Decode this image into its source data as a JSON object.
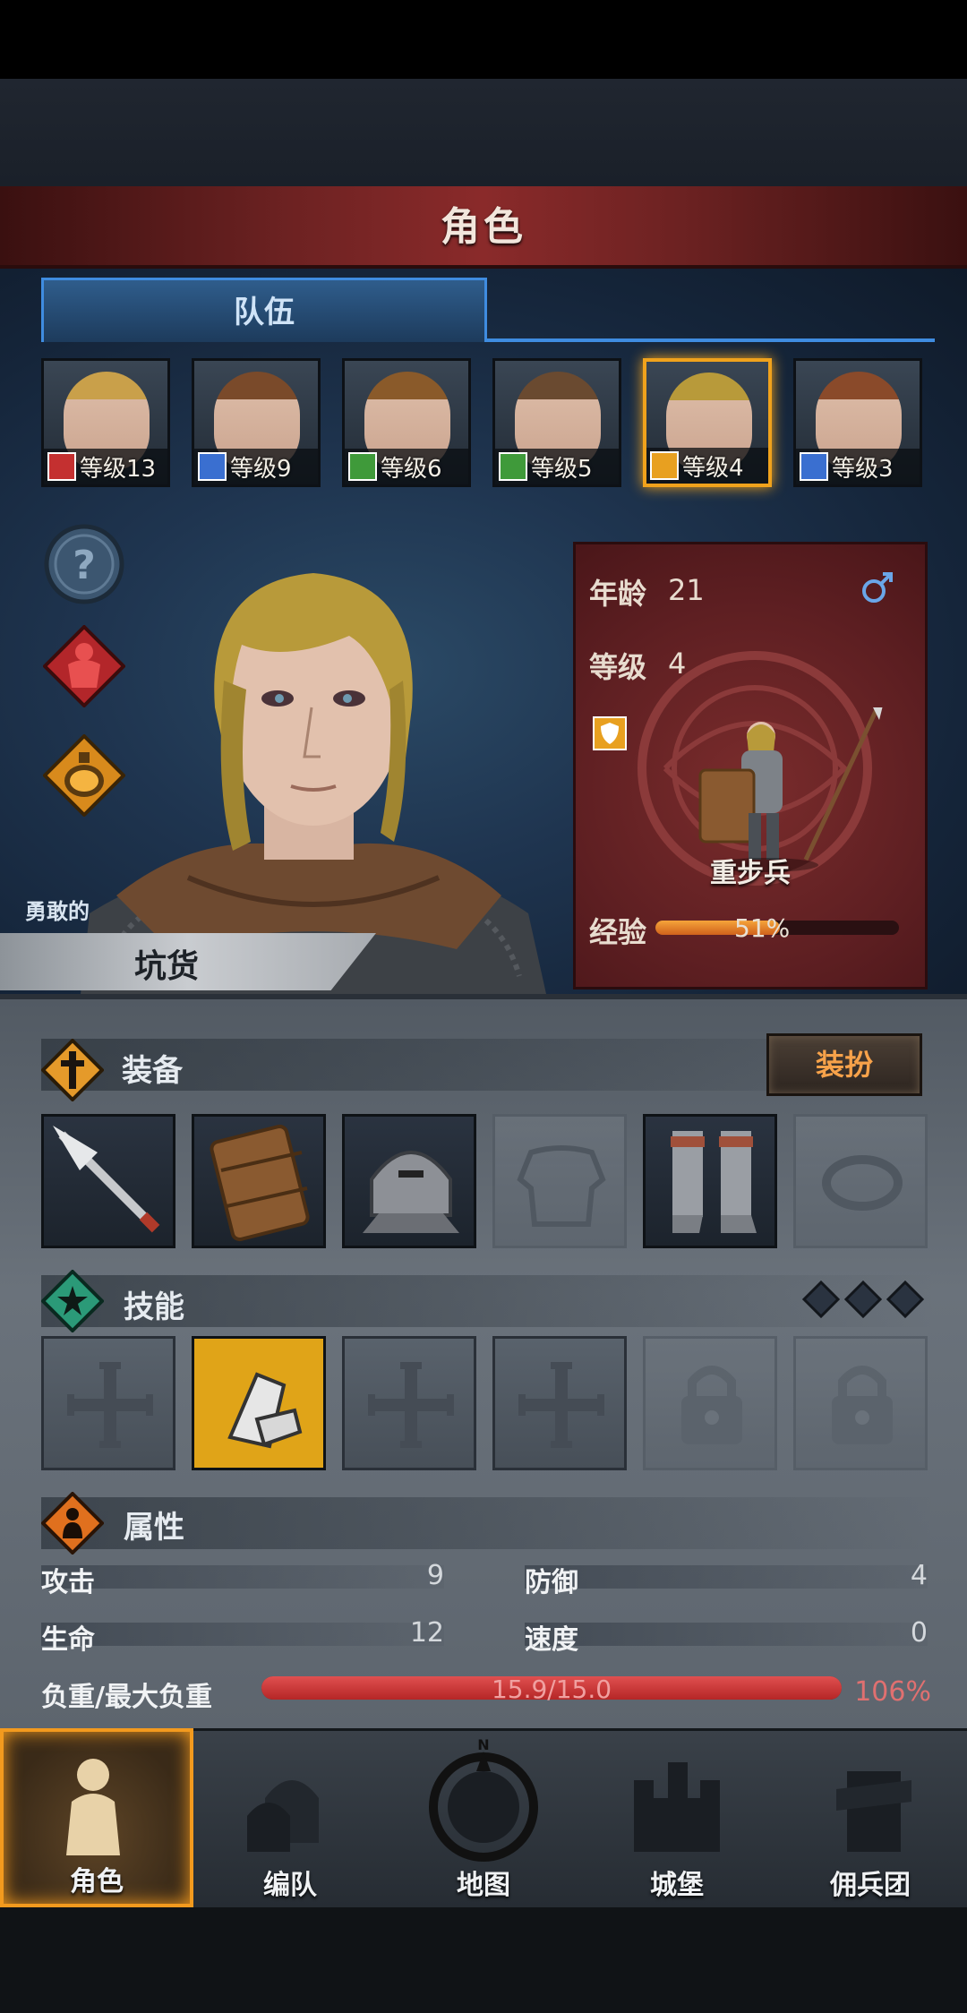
{
  "header": {
    "title": "角色"
  },
  "tabs": [
    {
      "label": "队伍",
      "active": true
    }
  ],
  "roster": [
    {
      "level_label": "等级13",
      "class_icon": "horse-icon",
      "class_color": "#c43030",
      "selected": false,
      "hair": "#c9a04a"
    },
    {
      "level_label": "等级9",
      "class_icon": "sword-icon",
      "class_color": "#3a6fd0",
      "selected": false,
      "hair": "#7a4a2a"
    },
    {
      "level_label": "等级6",
      "class_icon": "crossed-swords-icon",
      "class_color": "#3f9a3a",
      "selected": false,
      "hair": "#8a5a2a"
    },
    {
      "level_label": "等级5",
      "class_icon": "crossed-swords-icon",
      "class_color": "#3f9a3a",
      "selected": false,
      "hair": "#6a4a30"
    },
    {
      "level_label": "等级4",
      "class_icon": "shield-icon",
      "class_color": "#e8a020",
      "selected": true,
      "hair": "#b89a3a"
    },
    {
      "level_label": "等级3",
      "class_icon": "sword-icon",
      "class_color": "#3a6fd0",
      "selected": false,
      "hair": "#8a4a2a"
    }
  ],
  "side_buttons": [
    {
      "icon": "question-icon"
    },
    {
      "icon": "armor-icon"
    },
    {
      "icon": "potion-icon"
    }
  ],
  "character": {
    "trait": "勇敢的",
    "name": "坑货",
    "age_label": "年龄",
    "age": "21",
    "gender_icon": "male-icon",
    "level_label": "等级",
    "level": "4",
    "class_name": "重步兵",
    "exp_label": "经验",
    "exp_percent_text": "51%",
    "exp_fraction": 0.51
  },
  "equipment": {
    "title": "装备",
    "button": "装扮",
    "slots": [
      {
        "icon": "spear-icon",
        "filled": true
      },
      {
        "icon": "wooden-shield-icon",
        "filled": true
      },
      {
        "icon": "helmet-icon",
        "filled": true
      },
      {
        "icon": "armor-slot-icon",
        "filled": false
      },
      {
        "icon": "boots-icon",
        "filled": true
      },
      {
        "icon": "ring-slot-icon",
        "filled": false
      }
    ]
  },
  "skills": {
    "title": "技能",
    "slots": [
      {
        "icon": "cross-icon",
        "state": "empty"
      },
      {
        "icon": "gauntlet-skill-icon",
        "state": "active"
      },
      {
        "icon": "cross-icon",
        "state": "empty"
      },
      {
        "icon": "cross-icon",
        "state": "empty"
      },
      {
        "icon": "lock-icon",
        "state": "locked"
      },
      {
        "icon": "lock-icon",
        "state": "locked"
      }
    ]
  },
  "attributes": {
    "title": "属性",
    "attack_label": "攻击",
    "attack": "9",
    "defense_label": "防御",
    "defense": "4",
    "health_label": "生命",
    "health": "12",
    "speed_label": "速度",
    "speed": "0",
    "load_label": "负重/最大负重",
    "load_text": "15.9/15.0",
    "load_percent": "106%",
    "load_fraction": 1.06
  },
  "nav": [
    {
      "label": "角色",
      "icon": "knight-icon",
      "selected": true
    },
    {
      "label": "编队",
      "icon": "helmet-group-icon",
      "selected": false
    },
    {
      "label": "地图",
      "icon": "compass-icon",
      "selected": false
    },
    {
      "label": "城堡",
      "icon": "castle-icon",
      "selected": false
    },
    {
      "label": "佣兵团",
      "icon": "mercenary-icon",
      "selected": false
    }
  ],
  "colors": {
    "accent": "#f0a21c",
    "tab_blue": "#3f8ce0",
    "banner_red": "#8a2a2a",
    "load_red": "#c22f2f"
  }
}
